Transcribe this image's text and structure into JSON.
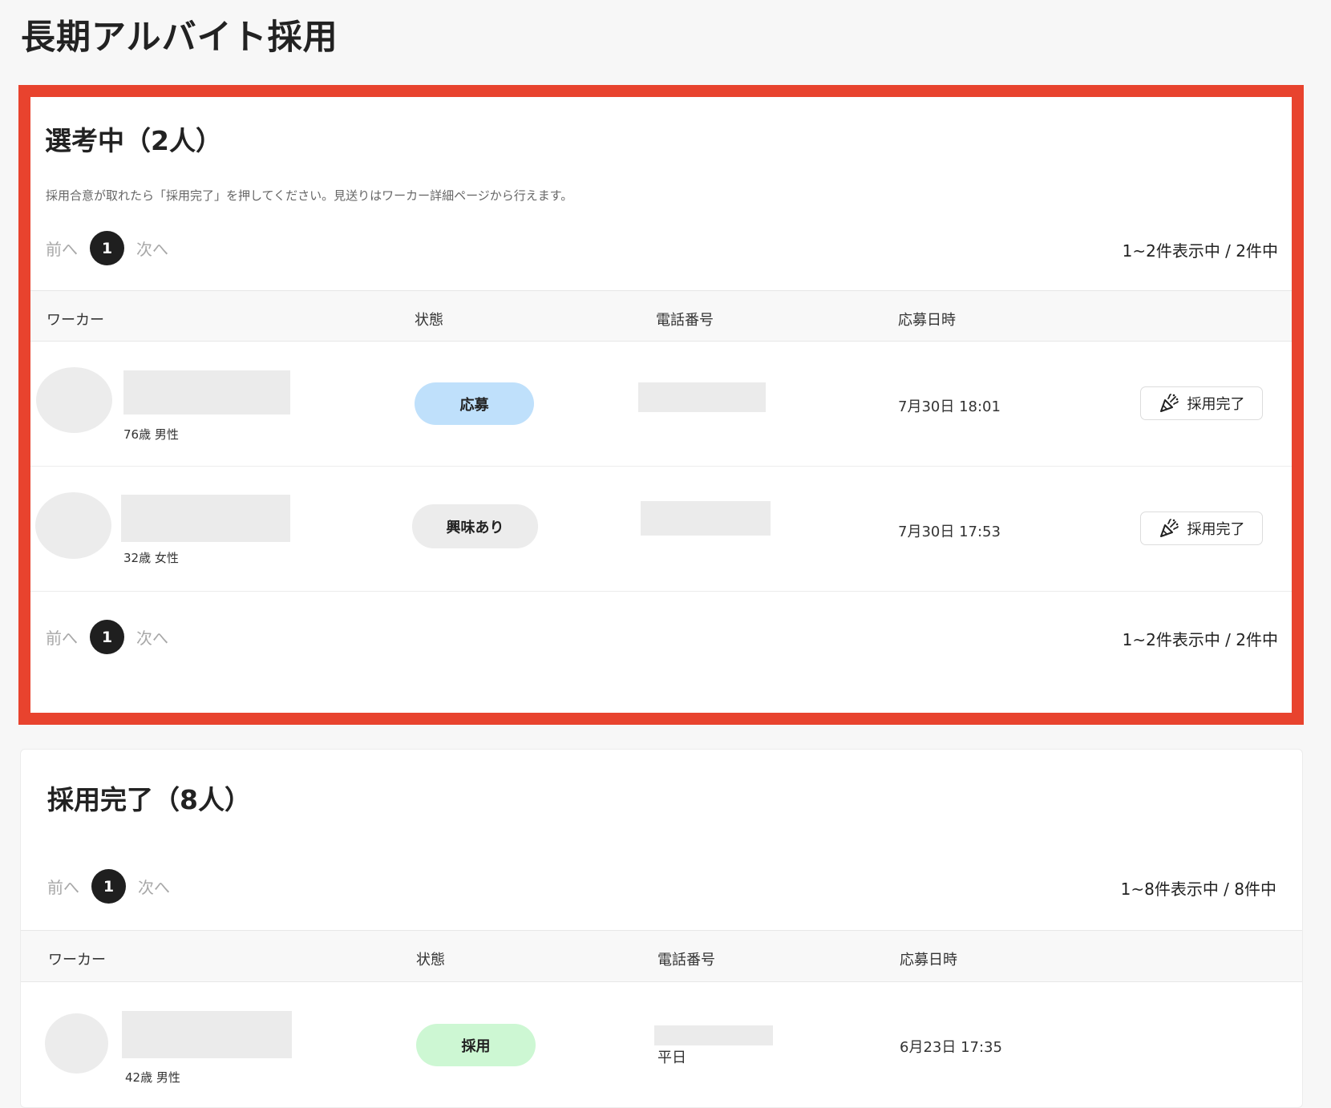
{
  "page": {
    "title": "長期アルバイト採用"
  },
  "pager": {
    "prev": "前へ",
    "next": "次へ"
  },
  "columns": {
    "worker": "ワーカー",
    "status": "状態",
    "phone": "電話番号",
    "applied_at": "応募日時"
  },
  "screening": {
    "title": "選考中（2人）",
    "note": "採用合意が取れたら「採用完了」を押してください。見送りはワーカー詳細ページから行えます。",
    "page": "1",
    "count": "1~2件表示中 / 2件中",
    "rows": [
      {
        "meta": "76歳 男性",
        "status": "応募",
        "date": "7月30日 18:01",
        "action": "採用完了"
      },
      {
        "meta": "32歳 女性",
        "status": "興味あり",
        "date": "7月30日 17:53",
        "action": "採用完了"
      }
    ]
  },
  "hired": {
    "title": "採用完了（8人）",
    "page": "1",
    "count": "1~8件表示中 / 8件中",
    "rows": [
      {
        "meta": "42歳 男性",
        "status": "採用",
        "phone_note": "平日",
        "date": "6月23日 17:35"
      }
    ]
  },
  "colors": {
    "highlight_border": "#e8432e",
    "badge_applied": "#bfe0fb",
    "badge_interested": "#ececec",
    "badge_hired": "#cdf7d3"
  },
  "icons": {
    "hire_action": "party-popper-icon"
  }
}
